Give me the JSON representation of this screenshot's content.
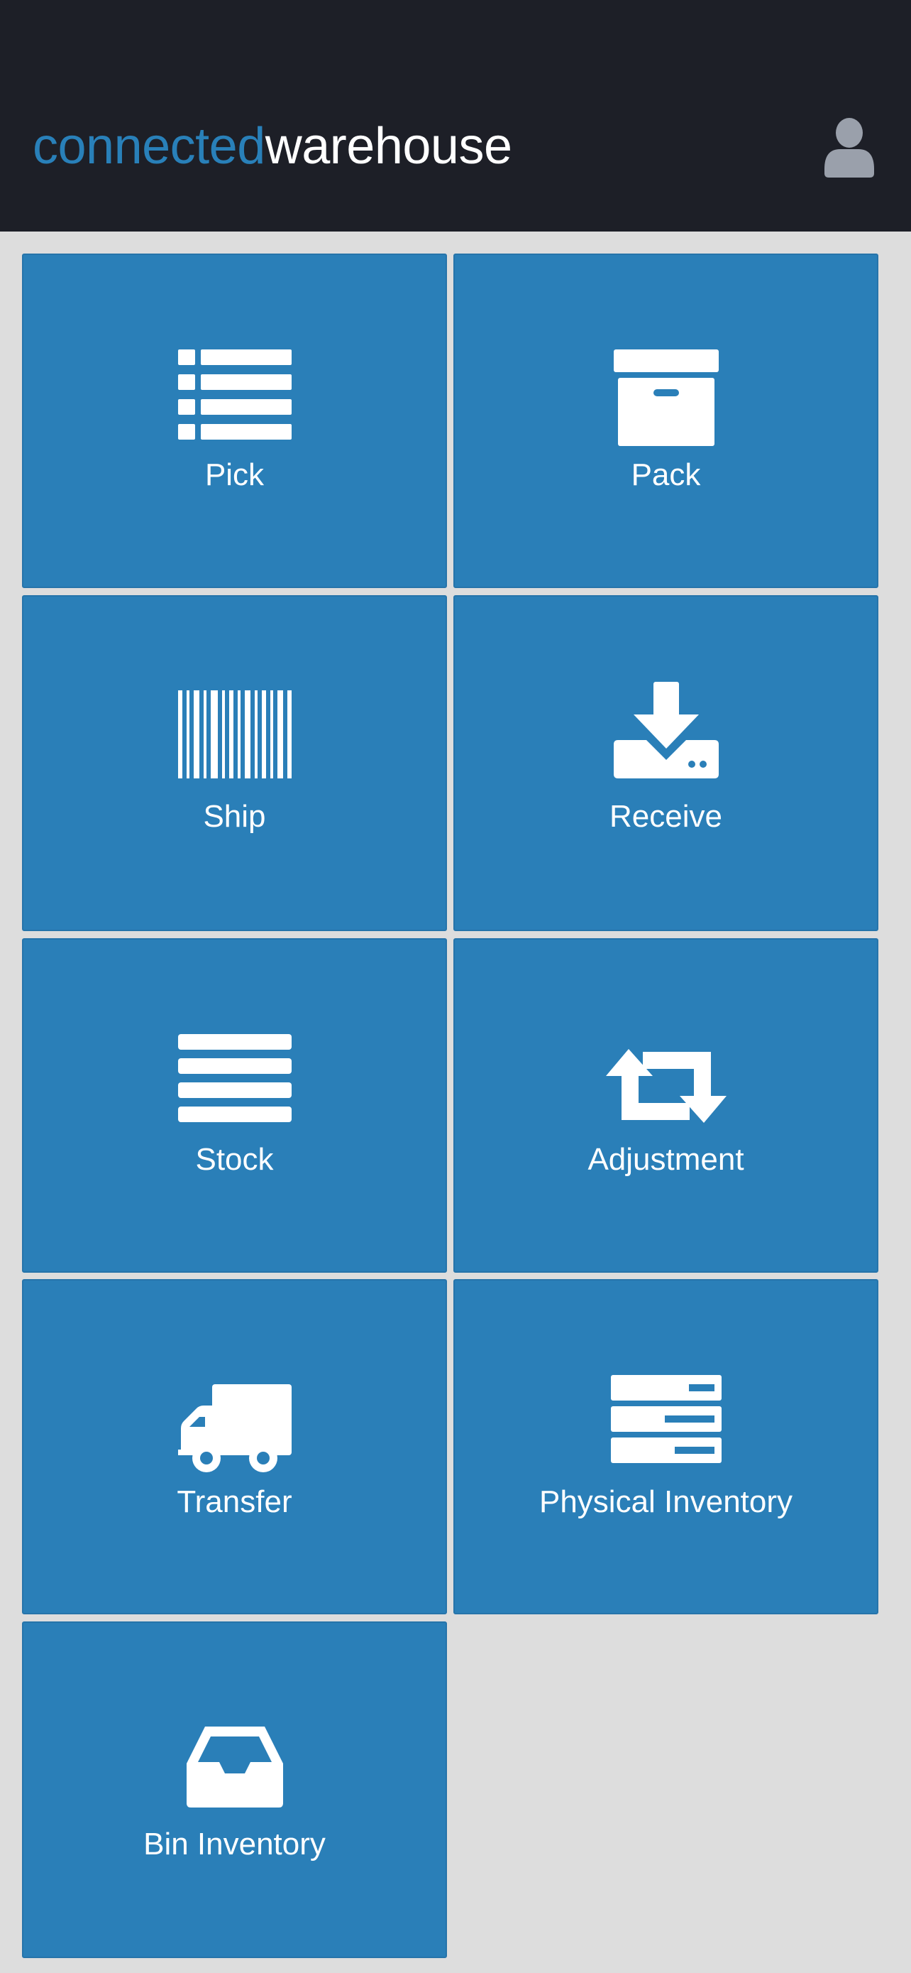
{
  "header": {
    "brand_part1": "connected",
    "brand_part2": "warehouse",
    "user_icon": "user-icon"
  },
  "colors": {
    "header_bg": "#1d1f27",
    "brand_accent": "#2980b9",
    "tile_bg": "#2a7fb8",
    "page_bg": "#dddddd",
    "user_icon": "#9aa0ab"
  },
  "tiles": [
    {
      "label": "Pick",
      "icon": "list-icon"
    },
    {
      "label": "Pack",
      "icon": "archive-box-icon"
    },
    {
      "label": "Ship",
      "icon": "barcode-icon"
    },
    {
      "label": "Receive",
      "icon": "download-tray-icon"
    },
    {
      "label": "Stock",
      "icon": "lines-icon"
    },
    {
      "label": "Adjustment",
      "icon": "retweet-arrows-icon"
    },
    {
      "label": "Transfer",
      "icon": "truck-icon"
    },
    {
      "label": "Physical Inventory",
      "icon": "server-stack-icon"
    },
    {
      "label": "Bin Inventory",
      "icon": "inbox-tray-icon"
    }
  ]
}
